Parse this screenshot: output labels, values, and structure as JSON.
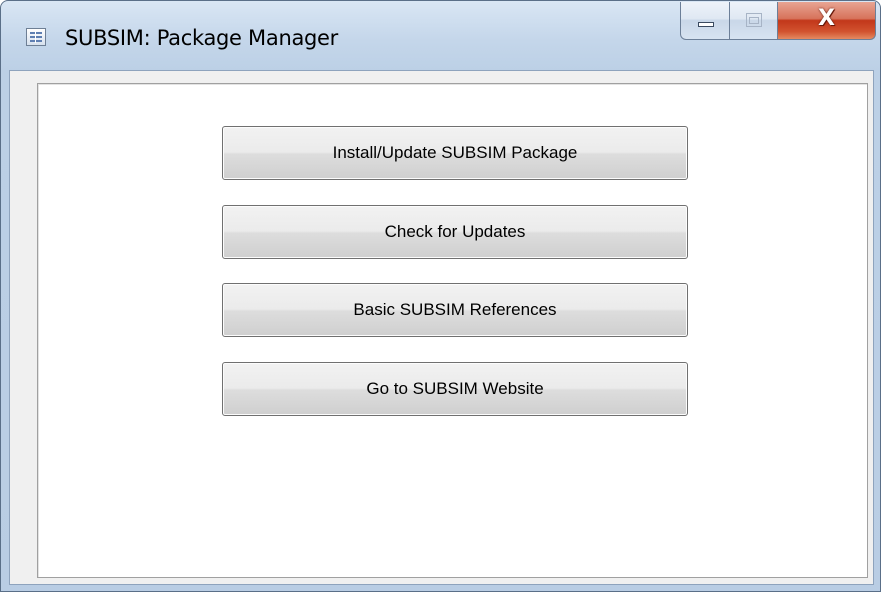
{
  "window": {
    "title": "SUBSIM: Package Manager",
    "icon": "form-window-icon",
    "controls": {
      "minimize": "minimize-icon",
      "maximize": "maximize-icon",
      "close": "close-icon",
      "close_glyph": "X"
    }
  },
  "main": {
    "buttons": [
      {
        "label": "Install/Update SUBSIM Package"
      },
      {
        "label": "Check for Updates"
      },
      {
        "label": "Basic SUBSIM References"
      },
      {
        "label": "Go to SUBSIM Website"
      }
    ]
  },
  "colors": {
    "title_frame": "#bcd0e6",
    "close_button": "#c2371a",
    "client_background": "#f0f0f0",
    "panel_background": "#ffffff"
  }
}
